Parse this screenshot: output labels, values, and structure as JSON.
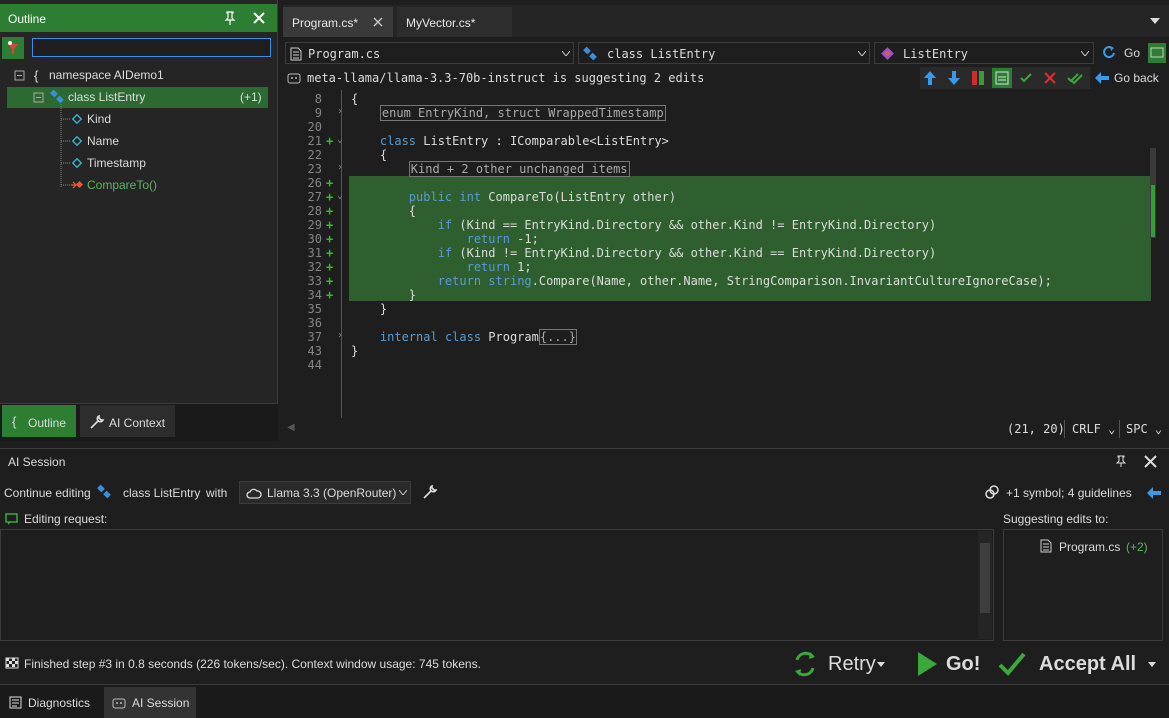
{
  "outline": {
    "title": "Outline",
    "search_placeholder": "",
    "tree": [
      {
        "label": "namespace AIDemo1",
        "icon": "namespace-icon"
      },
      {
        "label": "class ListEntry",
        "badge": "(+1)",
        "icon": "class-icon"
      },
      {
        "label": "Kind",
        "icon": "field-icon"
      },
      {
        "label": "Name",
        "icon": "field-icon"
      },
      {
        "label": "Timestamp",
        "icon": "field-icon"
      },
      {
        "label": "CompareTo()",
        "icon": "method-icon"
      }
    ],
    "tabs": [
      {
        "label": "Outline"
      },
      {
        "label": "AI Context"
      }
    ]
  },
  "editor": {
    "tabs": [
      {
        "label": "Program.cs*"
      },
      {
        "label": "MyVector.cs*"
      }
    ],
    "file_combo": "Program.cs",
    "type_combo": "class ListEntry",
    "member_combo": "ListEntry",
    "go_label": "Go",
    "suggest_text": "meta-llama/llama-3.3-70b-instruct is suggesting 2 edits",
    "go_back_label": "Go back",
    "lines": [
      {
        "n": "8",
        "mark": "",
        "fold": "",
        "text": "{"
      },
      {
        "n": "9",
        "mark": "",
        "fold": ">",
        "text": "    enum EntryKind, struct WrappedTimestamp"
      },
      {
        "n": "20",
        "mark": "",
        "fold": "",
        "text": ""
      },
      {
        "n": "21",
        "mark": "+",
        "fold": "v",
        "text": "    class ListEntry : IComparable<ListEntry>"
      },
      {
        "n": "22",
        "mark": "",
        "fold": "",
        "text": "    {"
      },
      {
        "n": "23",
        "mark": "",
        "fold": ">",
        "text": "        Kind + 2 other unchanged items"
      },
      {
        "n": "26",
        "mark": "+",
        "fold": "",
        "text": ""
      },
      {
        "n": "27",
        "mark": "+",
        "fold": "v",
        "text": "        public int CompareTo(ListEntry other)"
      },
      {
        "n": "28",
        "mark": "+",
        "fold": "",
        "text": "        {"
      },
      {
        "n": "29",
        "mark": "+",
        "fold": "",
        "text": "            if (Kind == EntryKind.Directory && other.Kind != EntryKind.Directory)"
      },
      {
        "n": "30",
        "mark": "+",
        "fold": "",
        "text": "                return -1;"
      },
      {
        "n": "31",
        "mark": "+",
        "fold": "",
        "text": "            if (Kind != EntryKind.Directory && other.Kind == EntryKind.Directory)"
      },
      {
        "n": "32",
        "mark": "+",
        "fold": "",
        "text": "                return 1;"
      },
      {
        "n": "33",
        "mark": "+",
        "fold": "",
        "text": "            return string.Compare(Name, other.Name, StringComparison.InvariantCultureIgnoreCase);"
      },
      {
        "n": "34",
        "mark": "+",
        "fold": "",
        "text": "        }"
      },
      {
        "n": "35",
        "mark": "",
        "fold": "",
        "text": "    }"
      },
      {
        "n": "36",
        "mark": "",
        "fold": "",
        "text": ""
      },
      {
        "n": "37",
        "mark": "",
        "fold": ">",
        "text": "    internal class Program{...}"
      },
      {
        "n": "43",
        "mark": "",
        "fold": "",
        "text": "}"
      },
      {
        "n": "44",
        "mark": "",
        "fold": "",
        "text": ""
      }
    ],
    "cursor_pos": "(21, 20)",
    "line_ending": "CRLF",
    "indent": "SPC"
  },
  "ai_session": {
    "title": "AI Session",
    "continue_label": "Continue editing",
    "target": "class ListEntry",
    "with_label": "with",
    "model": "Llama 3.3 (OpenRouter)",
    "context_summary": "+1 symbol; 4 guidelines",
    "editing_request_label": "Editing request:",
    "suggesting_label": "Suggesting edits to:",
    "suggest_file": "Program.cs",
    "suggest_file_delta": "(+2)",
    "status": "Finished step #3 in 0.8 seconds (226 tokens/sec). Context window usage: 745 tokens.",
    "retry_label": "Retry",
    "go_label": "Go!",
    "accept_label": "Accept All"
  },
  "bottom_tabs": [
    {
      "label": "Diagnostics"
    },
    {
      "label": "AI Session"
    }
  ],
  "colors": {
    "accent_green": "#2d7d32",
    "diff_green": "#2f5f2f",
    "keyword": "#569cd6"
  }
}
